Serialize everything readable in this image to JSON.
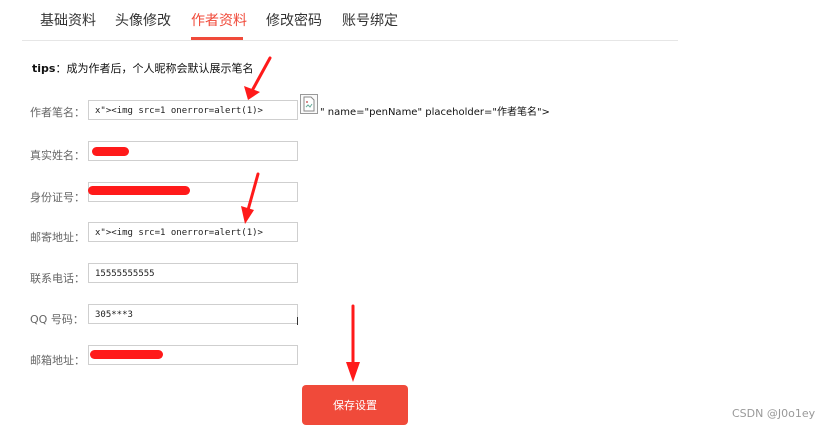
{
  "tabs": [
    {
      "label": "基础资料",
      "active": false
    },
    {
      "label": "头像修改",
      "active": false
    },
    {
      "label": "作者资料",
      "active": true
    },
    {
      "label": "修改密码",
      "active": false
    },
    {
      "label": "账号绑定",
      "active": false
    }
  ],
  "tips": {
    "prefix": "tips",
    "text": "：成为作者后，个人昵称会默认展示笔名"
  },
  "form": {
    "pen_name": {
      "label": "作者笔名：",
      "value": "x\"><img src=1 onerror=alert(1)>"
    },
    "real_name": {
      "label": "真实姓名："
    },
    "id_number": {
      "label": "身份证号："
    },
    "mail_address": {
      "label": "邮寄地址：",
      "value": "x\"><img src=1 onerror=alert(1)>"
    },
    "phone": {
      "label": "联系电话：",
      "value": "15555555555"
    },
    "qq": {
      "label": "QQ 号码：",
      "value": "305***3"
    },
    "email": {
      "label": "邮箱地址："
    }
  },
  "injected_text": "\" name=\"penName\" placeholder=\"作者笔名\">",
  "save_button": {
    "label": "保存设置"
  },
  "watermark": "CSDN @J0o1ey",
  "colors": {
    "accent": "#f04a3a",
    "redaction": "#ff1a1a"
  },
  "icons": [
    "broken-image-icon",
    "annotation-arrow-icon"
  ]
}
